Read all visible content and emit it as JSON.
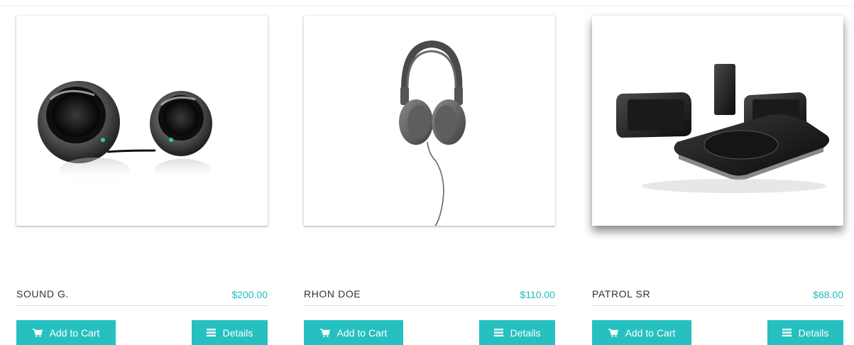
{
  "products": [
    {
      "name": "SOUND G.",
      "price": "$200.00",
      "image_icon": "speakers-icon",
      "add_to_cart_label": "Add to Cart",
      "details_label": "Details"
    },
    {
      "name": "RHON DOE",
      "price": "$110.00",
      "image_icon": "headphones-icon",
      "add_to_cart_label": "Add to Cart",
      "details_label": "Details"
    },
    {
      "name": "PATROL SR",
      "price": "$68.00",
      "image_icon": "home-theater-icon",
      "add_to_cart_label": "Add to Cart",
      "details_label": "Details"
    }
  ],
  "colors": {
    "accent": "#26c0c0",
    "price": "#1fbfbf",
    "text": "#333333",
    "divider": "#d9d9d9"
  }
}
